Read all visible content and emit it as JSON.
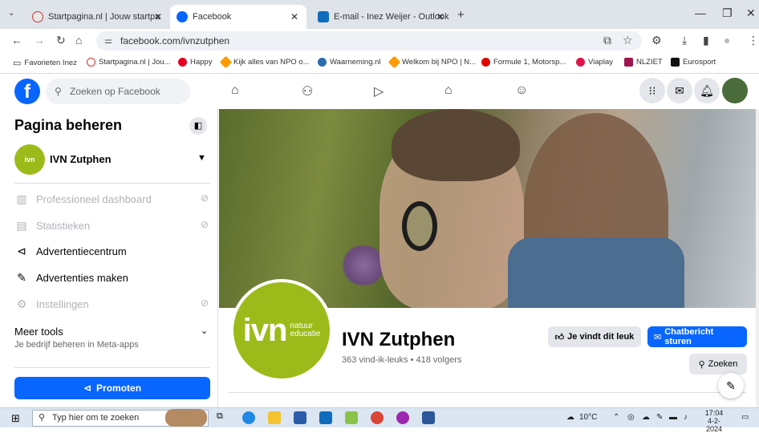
{
  "browser": {
    "tabs": [
      {
        "label": "Startpagina.nl | Jouw startpagi",
        "icon": "startpagina-icon",
        "active": false
      },
      {
        "label": "Facebook",
        "icon": "facebook-icon",
        "active": true
      },
      {
        "label": "E-mail - Inez Weijer - Outlook",
        "icon": "outlook-icon",
        "active": false
      }
    ],
    "url": "facebook.com/ivnzutphen",
    "bookmarks": [
      "Favorieten Inez",
      "Startpagina.nl | Jou...",
      "Happy",
      "Kijk alles van NPO o...",
      "Waarneming.nl",
      "Welkom bij NPO | N...",
      "Formule 1, Motorsp...",
      "Viaplay",
      "NLZIET",
      "Eurosport"
    ]
  },
  "facebook": {
    "search_placeholder": "Zoeken op Facebook",
    "sidebar": {
      "title": "Pagina beheren",
      "page_name": "IVN Zutphen",
      "items": [
        {
          "label": "Professioneel dashboard",
          "enabled": false
        },
        {
          "label": "Statistieken",
          "enabled": false
        },
        {
          "label": "Advertentiecentrum",
          "enabled": true
        },
        {
          "label": "Advertenties maken",
          "enabled": true
        },
        {
          "label": "Instellingen",
          "enabled": false
        }
      ],
      "more_tools_title": "Meer tools",
      "more_tools_subtitle": "Je bedrijf beheren in Meta-apps",
      "promote_label": "Promoten"
    },
    "page": {
      "name": "IVN Zutphen",
      "stats": "363 vind-ik-leuks • 418 volgers",
      "logo_main": "ivn",
      "logo_sub_1": "natuur",
      "logo_sub_2": "educatie",
      "like_button": "Je vindt dit leuk",
      "message_button": "Chatbericht sturen",
      "search_button": "Zoeken"
    }
  },
  "taskbar": {
    "search_placeholder": "Typ hier om te zoeken",
    "weather": "10°C",
    "time": "17:04",
    "date": "4-2-2024"
  },
  "colors": {
    "facebook_blue": "#0866ff",
    "ivn_green": "#9cbb1a"
  }
}
